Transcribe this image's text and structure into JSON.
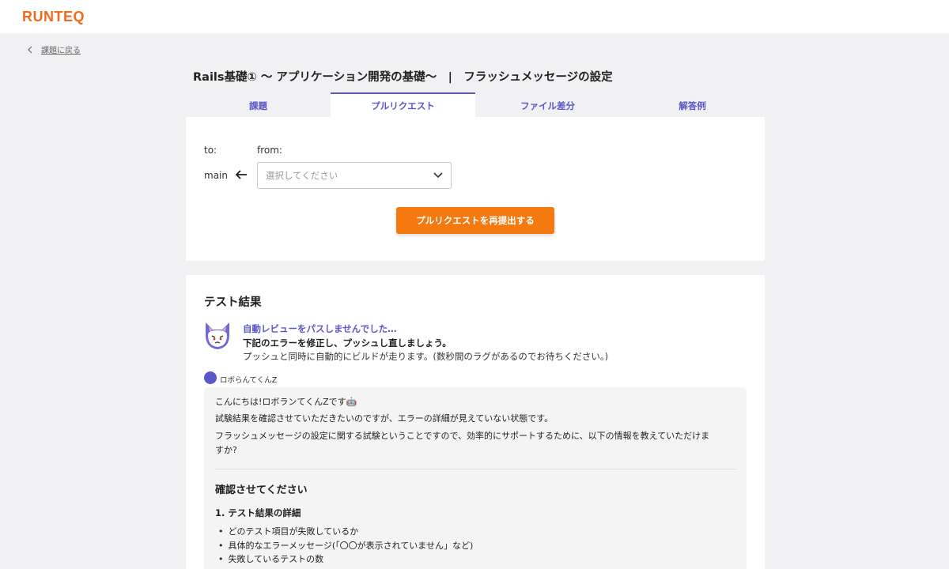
{
  "header": {
    "logo": "RUNTEQ"
  },
  "back_link": {
    "label": "課題に戻る"
  },
  "page_title": "Rails基礎① 〜 アプリケーション開発の基礎〜　|　フラッシュメッセージの設定",
  "tabs": [
    {
      "label": "課題",
      "active": false
    },
    {
      "label": "プルリクエスト",
      "active": true
    },
    {
      "label": "ファイル差分",
      "active": false
    },
    {
      "label": "解答例",
      "active": false
    }
  ],
  "pr_form": {
    "to_label": "to:",
    "from_label": "from:",
    "to_branch": "main",
    "from_placeholder": "選択してください",
    "submit_label": "プルリクエストを再提出する"
  },
  "test_results": {
    "title": "テスト結果",
    "fail_title": "自動レビューをパスしませんでした…",
    "fail_message": "下記のエラーを修正し、プッシュし直しましょう。",
    "fail_note": "プッシュと同時に自動的にビルドが走ります。(数秒間のラグがあるのでお待ちください。)",
    "bot_name": "ロボらんてくんZ",
    "message": {
      "line1": "こんにちは!ロボランてくんZです🤖",
      "line2": "試験結果を確認させていただきたいのですが、エラーの詳細が見えていない状態です。",
      "line3a": "フラッシュメッセージの設定に関する試験ということですので、効率的にサポートするために、以下の情報を教えていただけま",
      "line3b": "すか?",
      "heading": "確認させてください",
      "subheading": "1. テスト結果の詳細",
      "items": [
        "どのテスト項目が失敗しているか",
        "具体的なエラーメッセージ(「〇〇が表示されていません」など)",
        "失敗しているテストの数"
      ]
    }
  },
  "colors": {
    "brand": "#f26b1d",
    "accent": "#5a57c8",
    "button": "#f47a0f"
  }
}
